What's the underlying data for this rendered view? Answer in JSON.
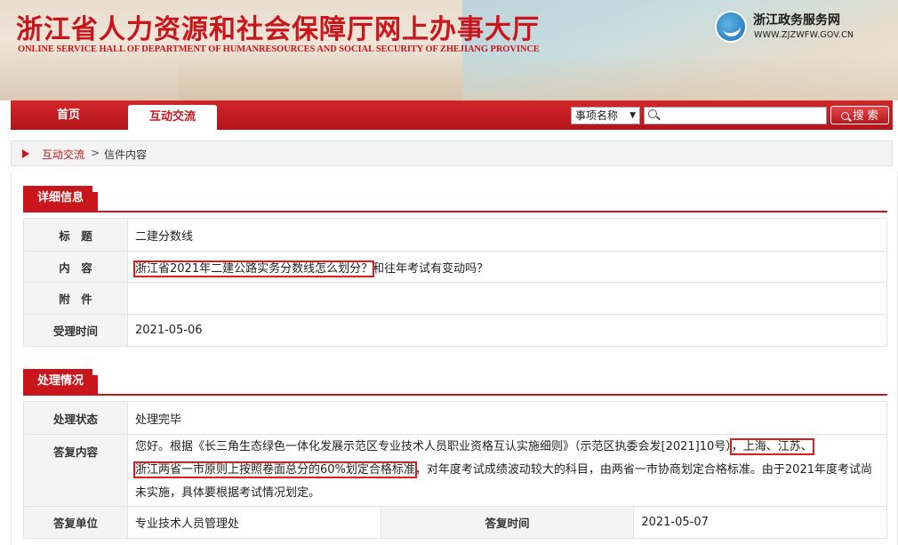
{
  "header": {
    "title": "浙江省人力资源和社会保障厅网上办事大厅",
    "subtitle": "ONLINE SERVICE HALL OF DEPARTMENT OF HUMANRESOURCES AND SOCIAL SECURITY OF ZHEJIANG PROVINCE",
    "portal_name": "浙江政务服务网",
    "portal_url": "WWW.ZJZWFW.GOV.CN"
  },
  "nav": {
    "home": "首页",
    "interact": "互动交流",
    "search_select": "事项名称",
    "search_placeholder": "",
    "search_button": "搜 索"
  },
  "breadcrumb": {
    "link": "互动交流",
    "separator": ">",
    "current": "信件内容"
  },
  "detail": {
    "section_title": "详细信息",
    "rows": [
      {
        "label": "标　题",
        "value": "二建分数线"
      },
      {
        "label": "内　容",
        "value_marked": "浙江省2021年二建公路实务分数线怎么划分？",
        "value_rest": "和往年考试有变动吗？"
      },
      {
        "label": "附　件",
        "value": ""
      },
      {
        "label": "受理时间",
        "value": "2021-05-06"
      }
    ]
  },
  "processing": {
    "section_title": "处理情况",
    "status_label": "处理状态",
    "status_value": "处理完毕",
    "answer_label": "答复内容",
    "answer_part1": "您好。根据《长三角生态绿色一体化发展示范区专业技术人员职业资格互认实施细则》（示范区执委会发[2021]10号）",
    "answer_marked1": "，上海、江苏、",
    "answer_marked2": "浙江两省一市原则上按照卷面总分的60%划定合格标准",
    "answer_part2": "，对年度考试成绩波动较大的科目，由两省一市协商划定合格标准。由于2021年度考试尚未实施，具体要根据考试情况划定。",
    "unit_label": "答复单位",
    "unit_value": "专业技术人员管理处",
    "time_label": "答复时间",
    "time_value": "2021-05-07"
  },
  "colors": {
    "brand_red": "#c9161d",
    "highlight_box": "#e01b1b"
  }
}
